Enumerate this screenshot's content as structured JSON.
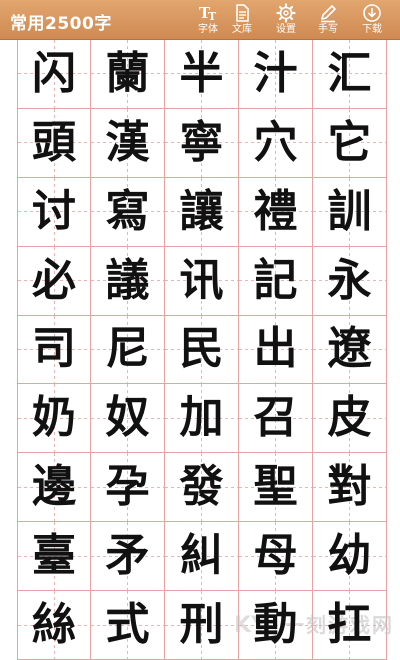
{
  "header": {
    "title": "常用2500字",
    "tools": [
      {
        "icon": "font-icon",
        "label": "字体"
      },
      {
        "icon": "document-icon",
        "label": "文库"
      },
      {
        "icon": "gear-icon",
        "label": "设置"
      },
      {
        "icon": "pencil-icon",
        "label": "手写"
      },
      {
        "icon": "download-icon",
        "label": "下载"
      }
    ],
    "colors": {
      "bar": "#d9965d",
      "grid": "#e8a2a2"
    }
  },
  "grid": {
    "rows": [
      [
        "闪",
        "蘭",
        "半",
        "汁",
        "汇"
      ],
      [
        "頭",
        "漢",
        "寧",
        "穴",
        "它"
      ],
      [
        "讨",
        "寫",
        "讓",
        "禮",
        "訓"
      ],
      [
        "必",
        "議",
        "讯",
        "記",
        "永"
      ],
      [
        "司",
        "尼",
        "民",
        "出",
        "遼"
      ],
      [
        "奶",
        "奴",
        "加",
        "召",
        "皮"
      ],
      [
        "邊",
        "孕",
        "發",
        "聖",
        "對"
      ],
      [
        "臺",
        "矛",
        "糾",
        "母",
        "幼"
      ],
      [
        "絲",
        "式",
        "刑",
        "動",
        "扛"
      ]
    ]
  },
  "watermark": {
    "text": "一刻游戏网"
  }
}
